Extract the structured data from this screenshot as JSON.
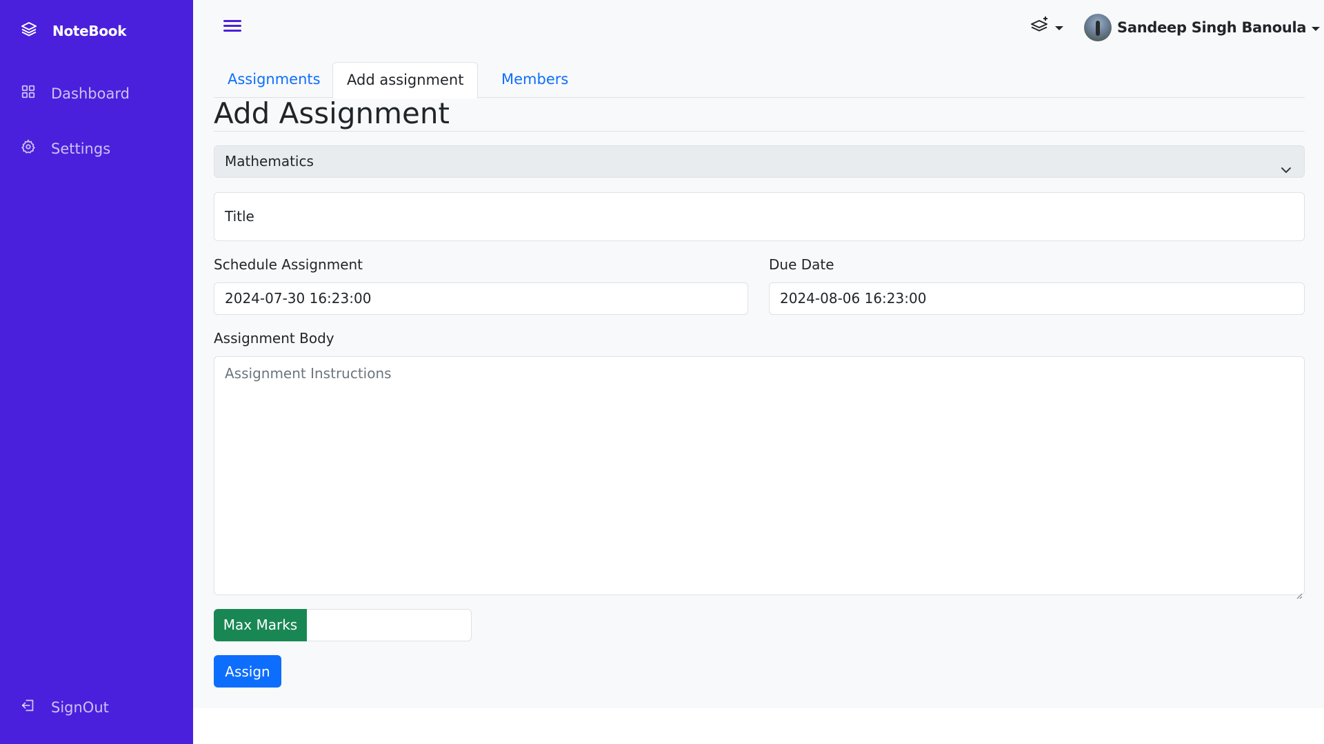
{
  "app": {
    "brand": "NoteBook"
  },
  "sidebar": {
    "items": [
      {
        "label": "Dashboard",
        "icon": "grid-icon"
      },
      {
        "label": "Settings",
        "icon": "gear-icon"
      }
    ],
    "signout": {
      "label": "SignOut",
      "icon": "signout-icon"
    }
  },
  "header": {
    "user_name": "Sandeep Singh Banoula"
  },
  "tabs": [
    {
      "label": "Assignments",
      "active": false
    },
    {
      "label": "Add assignment",
      "active": true
    },
    {
      "label": "Members",
      "active": false
    }
  ],
  "form": {
    "heading": "Add Assignment",
    "subject_select": {
      "value": "Mathematics"
    },
    "title_input": {
      "placeholder": "Title",
      "value": ""
    },
    "schedule": {
      "label": "Schedule Assignment",
      "value": "2024-07-30 16:23:00"
    },
    "due": {
      "label": "Due Date",
      "value": "2024-08-06 16:23:00"
    },
    "body": {
      "label": "Assignment Body",
      "placeholder": "Assignment Instructions"
    },
    "max_marks": {
      "label": "Max Marks",
      "value": ""
    },
    "submit_label": "Assign"
  },
  "colors": {
    "sidebar_bg": "#4a20dc",
    "primary": "#0d6efd",
    "success": "#198754",
    "main_bg": "#f8f9fa"
  }
}
